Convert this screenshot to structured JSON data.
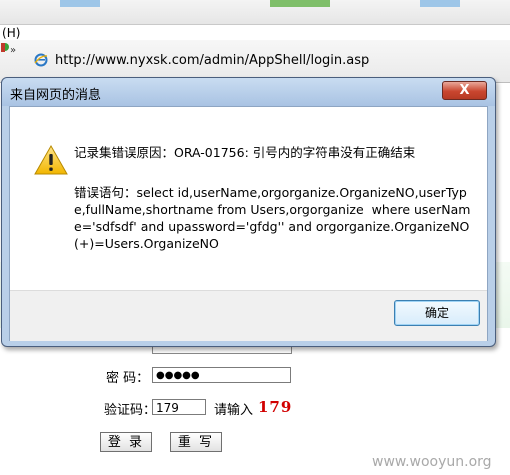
{
  "browser": {
    "menu_fragment": "H)",
    "address": "http://www.nyxsk.com/admin/AppShell/login.asp"
  },
  "dialog": {
    "title": "来自网页的消息",
    "close_label": "X",
    "message_line1": "记录集错误原因：ORA-01756: 引号内的字符串没有正确结束",
    "message_line2": "错误语句：select id,userName,orgorganize.OrganizeNO,userType,fullName,shortname from Users,orgorganize  where userName='sdfsdf' and upassword='gfdg'' and orgorganize.OrganizeNO(+)=Users.OrganizeNO",
    "ok_label": "确定"
  },
  "login_form": {
    "password_label": "密  码：",
    "password_value": "●●●●●",
    "captcha_label": "验证码：",
    "captcha_value": "179",
    "captcha_prompt": "请输入",
    "captcha_code": "179",
    "login_button": "登 录",
    "reset_button": "重 写"
  },
  "watermark": "www.wooyun.org"
}
